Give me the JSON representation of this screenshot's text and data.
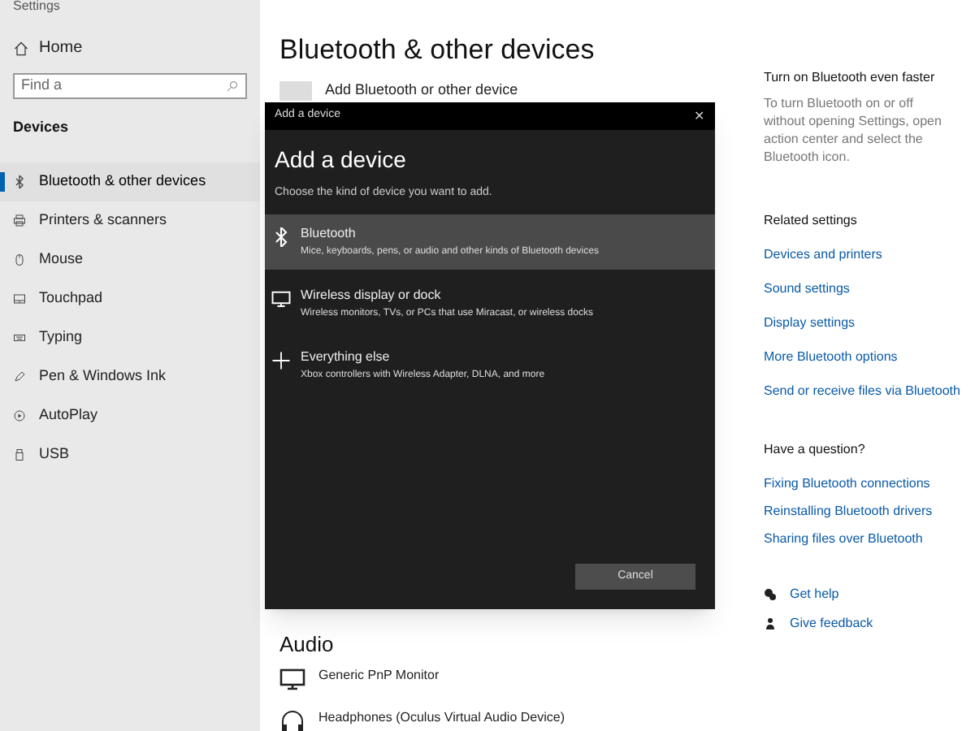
{
  "window": {
    "title": "Settings"
  },
  "sidebar": {
    "home": "Home",
    "search": {
      "placeholder": "Find a"
    },
    "section": "Devices",
    "items": [
      {
        "label": "Bluetooth & other devices",
        "selected": true
      },
      {
        "label": "Printers & scanners",
        "selected": false
      },
      {
        "label": "Mouse",
        "selected": false
      },
      {
        "label": "Touchpad",
        "selected": false
      },
      {
        "label": "Typing",
        "selected": false
      },
      {
        "label": "Pen & Windows Ink",
        "selected": false
      },
      {
        "label": "AutoPlay",
        "selected": false
      },
      {
        "label": "USB",
        "selected": false
      }
    ]
  },
  "main": {
    "title": "Bluetooth & other devices",
    "add_button": "Add Bluetooth or other device",
    "audio": {
      "title": "Audio",
      "devices": [
        {
          "name": "Generic PnP Monitor"
        },
        {
          "name": "Headphones (Oculus Virtual Audio Device)"
        }
      ]
    }
  },
  "aside": {
    "tip": {
      "title": "Turn on Bluetooth even faster",
      "text": "To turn Bluetooth on or off without opening Settings, open action center and select the Bluetooth icon."
    },
    "related": {
      "title": "Related settings",
      "links": [
        "Devices and printers",
        "Sound settings",
        "Display settings",
        "More Bluetooth options",
        "Send or receive files via Bluetooth"
      ]
    },
    "question": {
      "title": "Have a question?",
      "links": [
        "Fixing Bluetooth connections",
        "Reinstalling Bluetooth drivers",
        "Sharing files over Bluetooth"
      ]
    },
    "help": [
      "Get help",
      "Give feedback"
    ]
  },
  "dialog": {
    "title": "Add a device",
    "close": "✕",
    "heading": "Add a device",
    "subtitle": "Choose the kind of device you want to add.",
    "options": [
      {
        "title": "Bluetooth",
        "description": "Mice, keyboards, pens, or audio and other kinds of Bluetooth devices",
        "selected": true
      },
      {
        "title": "Wireless display or dock",
        "description": "Wireless monitors, TVs, or PCs that use Miracast, or wireless docks",
        "selected": false
      },
      {
        "title": "Everything else",
        "description": "Xbox controllers with Wireless Adapter, DLNA, and more",
        "selected": false
      }
    ],
    "cancel": "Cancel"
  }
}
